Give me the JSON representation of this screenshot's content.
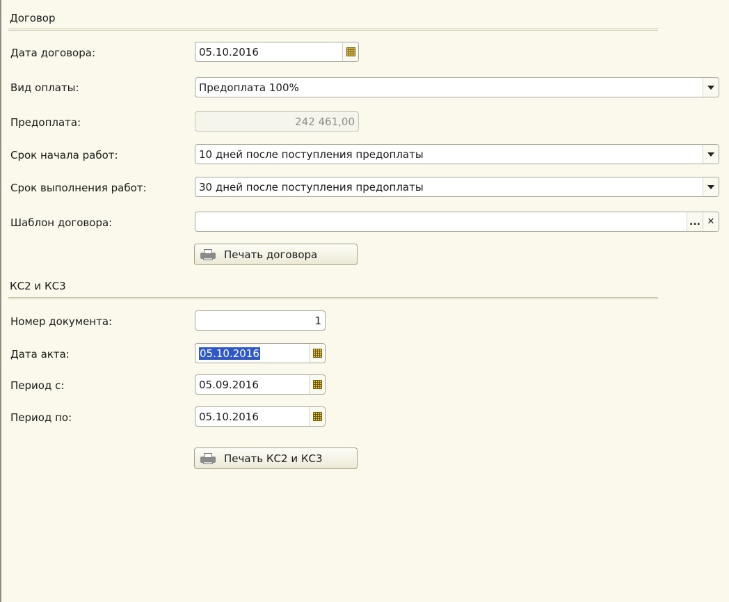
{
  "contract": {
    "title": "Договор",
    "date_label": "Дата договора:",
    "date_value": "05.10.2016",
    "payment_type_label": "Вид оплаты:",
    "payment_type_value": "Предоплата 100%",
    "prepayment_label": "Предоплата:",
    "prepayment_value": "242 461,00",
    "start_label": "Срок начала работ:",
    "start_value": "10 дней после поступления предоплаты",
    "duration_label": "Срок выполнения работ:",
    "duration_value": "30 дней после поступления предоплаты",
    "template_label": "Шаблон договора:",
    "template_value": "",
    "ellipsis": "...",
    "clear": "✕",
    "print_label": "Печать договора"
  },
  "ks": {
    "title": "КС2 и КС3",
    "docnum_label": "Номер документа:",
    "docnum_value": "1",
    "act_date_label": "Дата акта:",
    "act_date_value": "05.10.2016",
    "period_from_label": "Период с:",
    "period_from_value": "05.09.2016",
    "period_to_label": "Период по:",
    "period_to_value": "05.10.2016",
    "print_label": "Печать КС2 и КС3"
  },
  "colors": {
    "background": "#fbf9eb",
    "selection": "#2e58c9"
  },
  "icons": {
    "calendar": "calendar-icon",
    "dropdown": "chevron-down-icon",
    "printer": "printer-icon",
    "clear": "close-icon"
  }
}
